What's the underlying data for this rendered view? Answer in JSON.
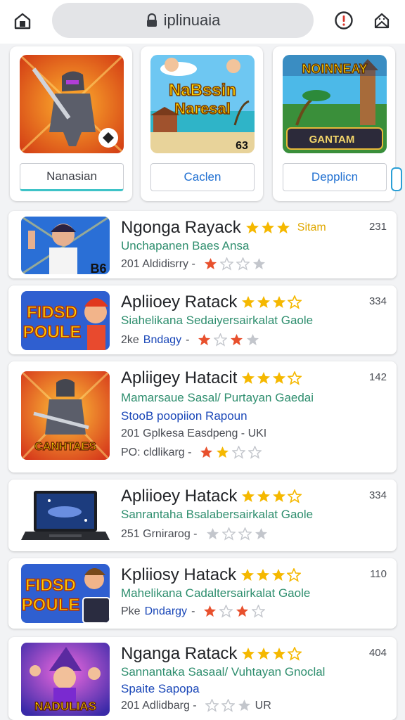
{
  "browser": {
    "url": "iplinuaia",
    "icons": [
      "home-icon",
      "lock-icon",
      "alert-icon",
      "share-icon"
    ]
  },
  "featured": [
    {
      "button": "Nanasian",
      "style": "dark"
    },
    {
      "button": "Caclen",
      "art_text": [
        "NaBssin",
        "Naresal"
      ],
      "badge": "63"
    },
    {
      "button": "Depplicn",
      "art_text": [
        "NOINNEAY",
        "GANTAM"
      ]
    }
  ],
  "list": [
    {
      "title": "Ngonga Rayack",
      "tag": "Sitam",
      "count": "231",
      "sub1": "Unchapanen Baes Ansa",
      "meta_prefix": "201 Aldidisrry -",
      "meta_hl": "",
      "meta_suffix": "",
      "badge": "B6",
      "stars": [
        "on",
        "off",
        "off",
        "off"
      ]
    },
    {
      "title": "Apliioey Ratack",
      "tag": "",
      "count": "334",
      "sub1": "Siahelikana Sedaiyersairkalat Gaole",
      "meta_prefix": "2ke",
      "meta_hl": "Bndagy",
      "meta_suffix": "-",
      "art_text": [
        "FIDSD",
        "POULE"
      ],
      "stars": [
        "on",
        "off",
        "on",
        "off"
      ]
    },
    {
      "title": "Apliigey Hatacit",
      "tag": "",
      "count": "142",
      "sub1": "Mamarsaue Sasal/ Purtayan Gaedai",
      "sub2": "StooB poopiion Rapoun",
      "sub3": "201 Gplkesa Easdpeng - UKI",
      "meta_prefix": "PO: cldlikarg -",
      "meta_hl": "",
      "meta_suffix": "",
      "art_text": [
        "CANHTAES"
      ],
      "stars": [
        "on",
        "on",
        "off",
        "off"
      ]
    },
    {
      "title": "Apliioey Hatack",
      "tag": "",
      "count": "334",
      "sub1": "Sanrantaha Bsalabersairkalat Gaole",
      "meta_prefix": "251 Grnirarog -",
      "meta_hl": "",
      "meta_suffix": "",
      "stars": [
        "off",
        "off",
        "off",
        "off"
      ]
    },
    {
      "title": "Kpliiosy Hatack",
      "tag": "",
      "count": "110",
      "sub1": "Mahelikana Cadaltersairkalat Gaole",
      "meta_prefix": "Pke",
      "meta_hl": "Dndargy",
      "meta_suffix": "-",
      "art_text": [
        "FIDSD",
        "POULE"
      ],
      "stars": [
        "on",
        "off",
        "on",
        "off"
      ]
    },
    {
      "title": "Nganga Ratack",
      "tag": "",
      "count": "404",
      "sub1": "Sannantaka Sasaal/ Vuhtayan Gnoclal",
      "sub2": "Spaite Sapopa",
      "sub3": "",
      "meta_prefix": "201 Adlidbarg -",
      "meta_hl": "",
      "meta_suffix": "UR",
      "art_text": [
        "NADULIAS"
      ],
      "stars": [
        "off",
        "off",
        "off"
      ]
    }
  ],
  "colors": {
    "star_gold": "#f5b800",
    "star_red": "#e8502d",
    "star_gray": "#c3c6cc",
    "link_blue": "#1f6fd1",
    "sub_green": "#2e8e6e"
  }
}
